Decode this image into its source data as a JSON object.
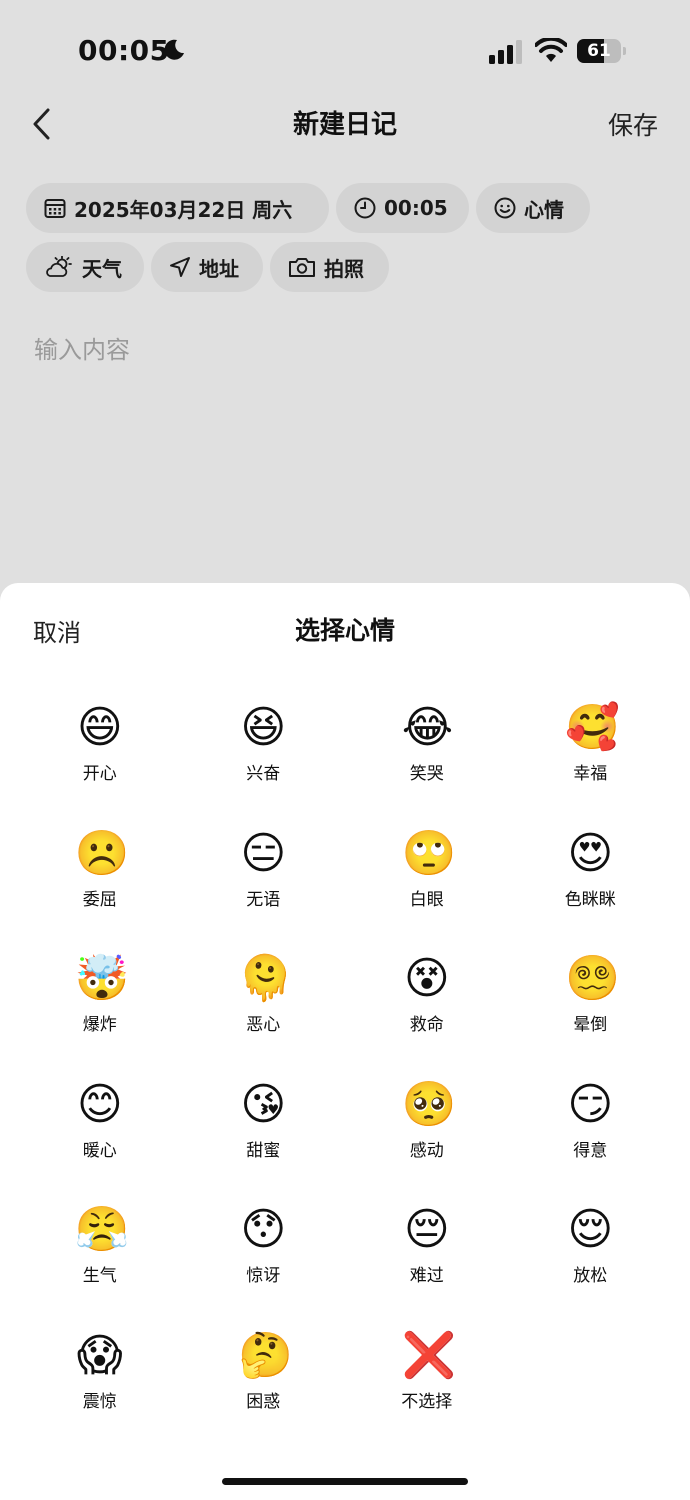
{
  "status_bar": {
    "time": "00:05",
    "battery": "61",
    "battery_level": 0.61
  },
  "nav": {
    "title": "新建日记",
    "save_label": "保存"
  },
  "chips": {
    "date": "2025年03月22日 周六",
    "time": "00:05",
    "mood": "心情",
    "weather": "天气",
    "location": "地址",
    "photo": "拍照"
  },
  "editor": {
    "placeholder": "输入内容"
  },
  "mood_sheet": {
    "cancel_label": "取消",
    "title": "选择心情",
    "moods": [
      {
        "emoji": "😄",
        "label": "开心"
      },
      {
        "emoji": "😆",
        "label": "兴奋"
      },
      {
        "emoji": "😂",
        "label": "笑哭"
      },
      {
        "emoji": "🥰",
        "label": "幸福"
      },
      {
        "emoji": "☹️",
        "label": "委屈"
      },
      {
        "emoji": "😑",
        "label": "无语"
      },
      {
        "emoji": "🙄",
        "label": "白眼"
      },
      {
        "emoji": "😍",
        "label": "色眯眯"
      },
      {
        "emoji": "🤯",
        "label": "爆炸"
      },
      {
        "emoji": "🫠",
        "label": "恶心"
      },
      {
        "emoji": "😵",
        "label": "救命"
      },
      {
        "emoji": "😵‍💫",
        "label": "晕倒"
      },
      {
        "emoji": "😊",
        "label": "暖心"
      },
      {
        "emoji": "😘",
        "label": "甜蜜"
      },
      {
        "emoji": "🥺",
        "label": "感动"
      },
      {
        "emoji": "😏",
        "label": "得意"
      },
      {
        "emoji": "😤",
        "label": "生气"
      },
      {
        "emoji": "😯",
        "label": "惊讶"
      },
      {
        "emoji": "😔",
        "label": "难过"
      },
      {
        "emoji": "😌",
        "label": "放松"
      },
      {
        "emoji": "😱",
        "label": "震惊"
      },
      {
        "emoji": "🤔",
        "label": "困惑"
      },
      {
        "emoji": "❌",
        "label": "不选择"
      }
    ]
  },
  "colors": {
    "background": "#e0e0e0",
    "chip": "#d3d3d3",
    "sheet": "#ffffff",
    "no_select_red": "#e8141c"
  }
}
